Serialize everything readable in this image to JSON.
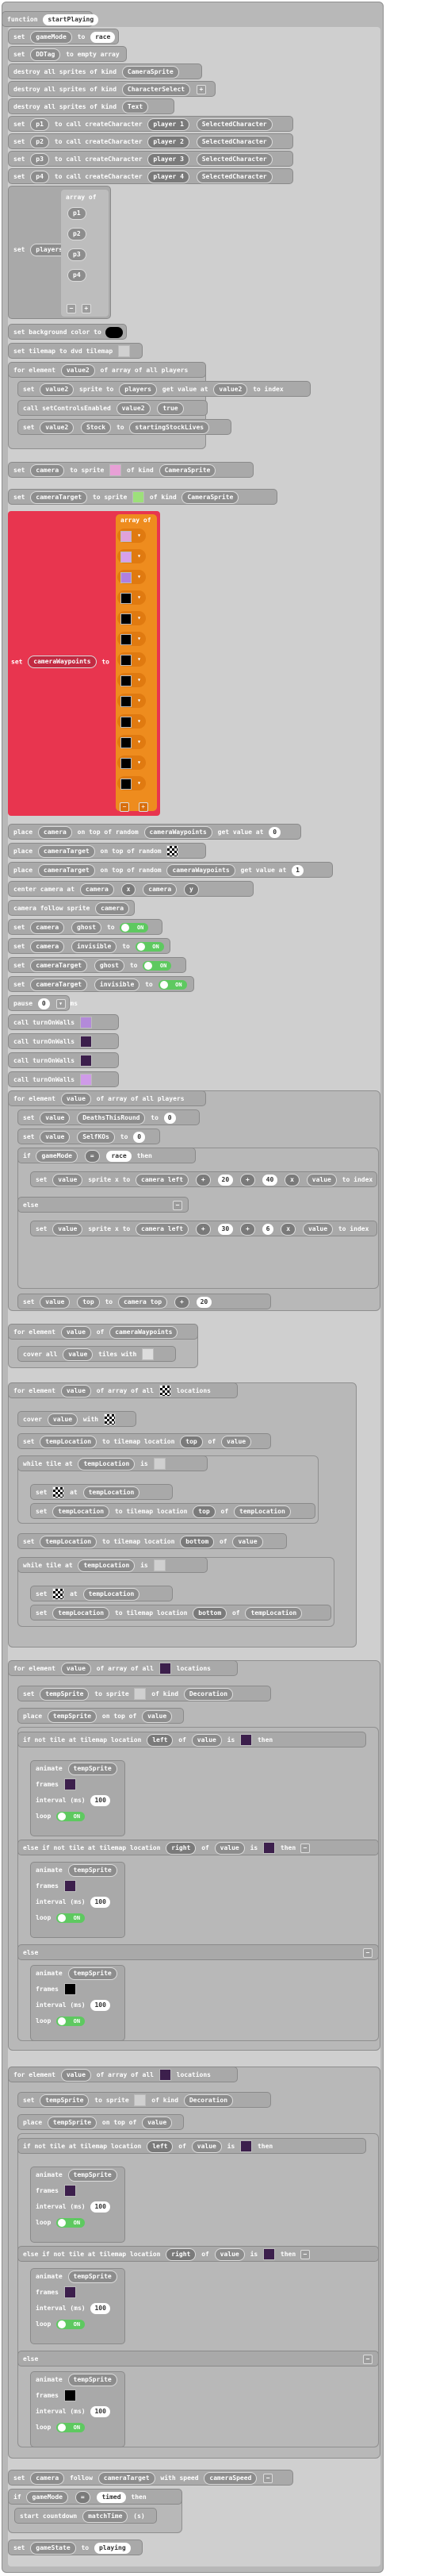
{
  "fn": {
    "keyword": "function",
    "name": "startPlaying"
  },
  "rows": {
    "set_gamemode": {
      "k": "set",
      "var": "gameMode",
      "to": "to",
      "val": "race"
    },
    "set_ddtag": {
      "k": "set",
      "var": "DDTag",
      "to": "to",
      "val": "empty array"
    },
    "destroy1": {
      "txt": "destroy all sprites of kind",
      "kind": "CameraSprite"
    },
    "destroy2": {
      "txt": "destroy all sprites of kind",
      "kind": "CharacterSelect"
    },
    "destroy3": {
      "txt": "destroy all sprites of kind",
      "kind": "Text"
    },
    "p1": {
      "k": "set",
      "var": "p1",
      "mid": "to  call createCharacter",
      "player": "player 1",
      "sel": "SelectedCharacter"
    },
    "p2": {
      "k": "set",
      "var": "p2",
      "mid": "to  call createCharacter",
      "player": "player 2",
      "sel": "SelectedCharacter"
    },
    "p3": {
      "k": "set",
      "var": "p3",
      "mid": "to  call createCharacter",
      "player": "player 3",
      "sel": "SelectedCharacter"
    },
    "p4": {
      "k": "set",
      "var": "p4",
      "mid": "to  call createCharacter",
      "player": "player 4",
      "sel": "SelectedCharacter"
    },
    "players": {
      "k": "set",
      "var": "players",
      "to": "to",
      "arr": "array of",
      "items": [
        "p1",
        "p2",
        "p3",
        "p4"
      ]
    },
    "bg": {
      "txt": "set background color to"
    },
    "tilemap": {
      "txt": "set tilemap to",
      "val": "dvd tilemap"
    },
    "foreach1": {
      "txt": "for element",
      "var": "value2",
      "of": "of array of all players"
    },
    "fe1_a": {
      "k": "set",
      "var": "value2",
      "mid": "sprite to",
      "arr": "players",
      "get": "get value at",
      "idx": "value2",
      "tail": "to index"
    },
    "fe1_b": {
      "txt": "call setControlsEnabled",
      "var": "value2",
      "val": "true"
    },
    "fe1_c": {
      "k": "set",
      "var": "value2",
      "stock": "Stock",
      "to": "to",
      "val": "startingStockLives"
    },
    "camera": {
      "k": "set",
      "var": "camera",
      "mid": "to sprite",
      "kind_lbl": "of kind",
      "kind": "CameraSprite"
    },
    "cameraTarget": {
      "k": "set",
      "var": "cameraTarget",
      "mid": "to sprite",
      "kind_lbl": "of kind",
      "kind": "CameraSprite"
    },
    "waypoints": {
      "k": "set",
      "var": "cameraWaypoints",
      "to": "to",
      "arr": "array of",
      "count": 13
    },
    "place1": {
      "txt": "place",
      "var": "camera",
      "mid": "on top of random",
      "t": "cameraWaypoints",
      "get": "get value at",
      "idx": "0"
    },
    "place2": {
      "txt": "place",
      "var": "cameraTarget",
      "mid": "on top of random"
    },
    "place3": {
      "txt": "place",
      "var": "cameraTarget",
      "mid": "on top of random",
      "t": "cameraWaypoints",
      "get": "get value at",
      "idx": "1"
    },
    "center": {
      "txt": "center camera at",
      "var": "camera",
      "x": "x",
      "v2": "camera",
      "y": "y"
    },
    "follow": {
      "txt": "camera follow sprite",
      "var": "camera"
    },
    "sflag1": {
      "k": "set",
      "var": "camera",
      "flag": "ghost",
      "to": "to",
      "state": "ON"
    },
    "sflag2": {
      "k": "set",
      "var": "camera",
      "flag": "invisible",
      "to": "to",
      "state": "ON"
    },
    "sflag3": {
      "k": "set",
      "var": "cameraTarget",
      "flag": "ghost",
      "to": "to",
      "state": "ON"
    },
    "sflag4": {
      "k": "set",
      "var": "cameraTarget",
      "flag": "invisible",
      "to": "to",
      "state": "ON"
    },
    "pause": {
      "txt": "pause",
      "val": "0",
      "unit": "ms"
    },
    "turn1": {
      "txt": "call turnOnWalls"
    },
    "turn2": {
      "txt": "call turnOnWalls"
    },
    "turn3": {
      "txt": "call turnOnWalls"
    },
    "turn4": {
      "txt": "call turnOnWalls"
    },
    "foreach2": {
      "txt": "for element",
      "var": "value",
      "of": "of array of all players"
    },
    "fe2_a": {
      "k": "set",
      "var": "value",
      "mid": "DeathsThisRound",
      "to": "to",
      "val": "0"
    },
    "fe2_b": {
      "k": "set",
      "var": "value",
      "mid": "SelfKOs",
      "to": "to",
      "val": "0"
    },
    "fe2_if": {
      "txt": "if",
      "var": "gameMode",
      "op": "=",
      "val": "race",
      "then": "then"
    },
    "fe2_set1": {
      "k": "set",
      "var": "value",
      "mid": "sprite",
      "x": "x to",
      "cam": "camera left",
      "op1": "+",
      "a": "20",
      "op2": "+",
      "b": "40",
      "op3": "x",
      "v": "value",
      "tail": "to index"
    },
    "fe2_else": {
      "txt": "else"
    },
    "fe2_set2": {
      "k": "set",
      "var": "value",
      "mid": "sprite",
      "x": "x to",
      "cam": "camera left",
      "op1": "+",
      "a": "30",
      "op2": "+",
      "b": "6",
      "op3": "x",
      "v": "value",
      "tail": "to index"
    },
    "fe2_top": {
      "k": "set",
      "var": "value",
      "mid": "top",
      "to": "to",
      "cam": "camera top",
      "op": "+",
      "val": "20"
    },
    "foreach3": {
      "txt": "for element",
      "var": "value",
      "of": "of",
      "t": "cameraWaypoints"
    },
    "cover1": {
      "txt": "cover all",
      "var": "value",
      "tail": "tiles with"
    },
    "foreach4": {
      "txt": "for element",
      "var": "value",
      "of": "of array of all",
      "tail": "locations"
    },
    "fe4_cover": {
      "txt": "cover",
      "var": "value",
      "tail": "with"
    },
    "fe4_set1": {
      "k": "set",
      "var": "tempLocation",
      "mid": "to tilemap location",
      "dir": "top",
      "of": "of",
      "v": "value"
    },
    "fe4_while1": {
      "txt": "while",
      "t": "tile at",
      "v": "tempLocation",
      "is": "is"
    },
    "fe4_w1_set": {
      "txt": "set",
      "t": "at",
      "v": "tempLocation"
    },
    "fe4_w1_set2": {
      "k": "set",
      "var": "tempLocation",
      "mid": "to tilemap location",
      "dir": "top",
      "of": "of",
      "v": "tempLocation"
    },
    "fe4_set2": {
      "k": "set",
      "var": "tempLocation",
      "mid": "to tilemap location",
      "dir": "bottom",
      "of": "of",
      "v": "value"
    },
    "fe4_while2": {
      "txt": "while",
      "t": "tile at",
      "v": "tempLocation",
      "is": "is"
    },
    "fe4_w2_set": {
      "txt": "set",
      "t": "at",
      "v": "tempLocation"
    },
    "fe4_w2_set2": {
      "k": "set",
      "var": "tempLocation",
      "mid": "to tilemap location",
      "dir": "bottom",
      "of": "of",
      "v": "tempLocation"
    },
    "foreach5": {
      "txt": "for element",
      "var": "value",
      "of": "of array of all",
      "tail": "locations"
    },
    "fe5_set": {
      "k": "set",
      "var": "tempSprite",
      "mid": "to sprite",
      "kind_lbl": "of kind",
      "kind": "Decoration"
    },
    "fe5_place": {
      "txt": "place",
      "var": "tempSprite",
      "mid": "on top of",
      "v": "value"
    },
    "fe5_if": {
      "txt": "if",
      "not": "not",
      "t": "tile at",
      "loc": "tilemap location",
      "dir": "left",
      "of": "of",
      "v": "value",
      "is": "is",
      "then": "then"
    },
    "anim": {
      "txt": "animate",
      "var": "tempSprite",
      "frames": "frames",
      "interval": "interval (ms)",
      "ival": "100",
      "loop": "loop",
      "state": "ON"
    },
    "fe5_elseif": {
      "txt": "else if",
      "not": "not",
      "t": "tile at",
      "loc": "tilemap location",
      "dir": "right",
      "of": "of",
      "v": "value",
      "is": "is",
      "then": "then"
    },
    "fe5_else": {
      "txt": "else"
    },
    "foreach6": {
      "txt": "for element",
      "var": "value",
      "of": "of array of all",
      "tail": "locations"
    },
    "fe6_set": {
      "k": "set",
      "var": "tempSprite",
      "mid": "to sprite",
      "kind_lbl": "of kind",
      "kind": "Decoration"
    },
    "fe6_place": {
      "txt": "place",
      "var": "tempSprite",
      "mid": "on top of",
      "v": "value"
    },
    "fe6_if": {
      "txt": "if",
      "not": "not",
      "t": "tile at",
      "loc": "tilemap location",
      "dir": "left",
      "of": "of",
      "v": "value",
      "is": "is",
      "then": "then"
    },
    "fe6_elseif": {
      "txt": "else if",
      "not": "not",
      "t": "tile at",
      "loc": "tilemap location",
      "dir": "right",
      "of": "of",
      "v": "value",
      "is": "is",
      "then": "then"
    },
    "fe6_else": {
      "txt": "else"
    },
    "final_follow": {
      "k": "set",
      "var": "camera",
      "mid": "follow",
      "t": "cameraTarget",
      "tail": "with speed",
      "spd": "cameraSpeed"
    },
    "final_if": {
      "txt": "if",
      "var": "gameMode",
      "op": "=",
      "val": "timed",
      "then": "then"
    },
    "final_count": {
      "txt": "start countdown",
      "var": "matchTime",
      "unit": "(s)"
    },
    "final_state": {
      "k": "set",
      "var": "gameState",
      "to": "to",
      "val": "playing"
    }
  }
}
